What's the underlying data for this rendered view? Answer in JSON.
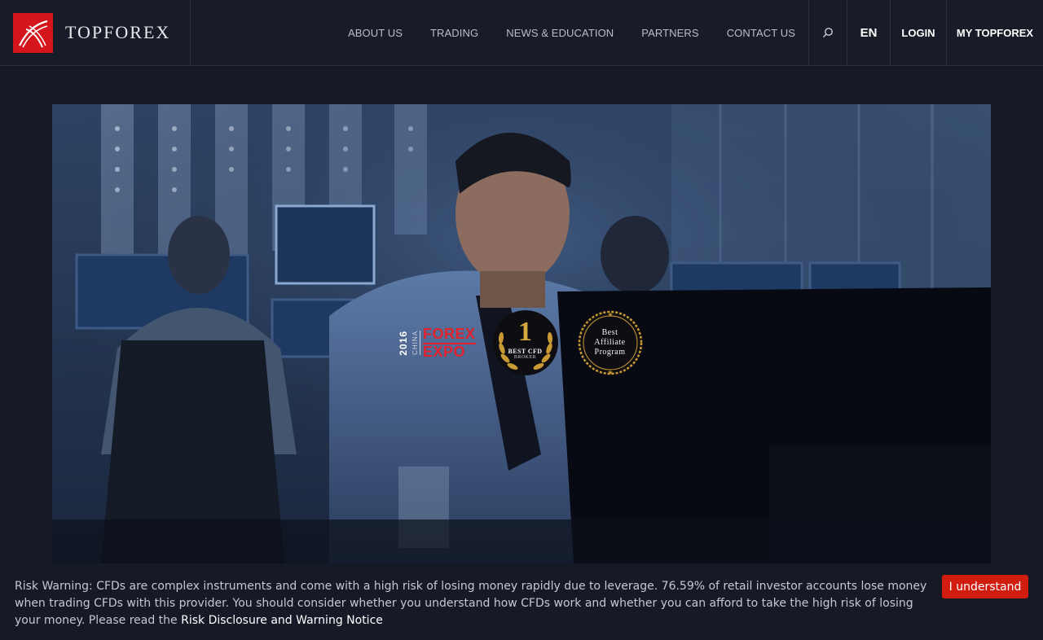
{
  "brand": {
    "name": "TOPFOREX",
    "logo_icon": "topforex-logo-swoosh",
    "logo_color": "#d4161c"
  },
  "nav": {
    "items": [
      {
        "label": "ABOUT US"
      },
      {
        "label": "TRADING"
      },
      {
        "label": "NEWS & EDUCATION"
      },
      {
        "label": "PARTNERS"
      },
      {
        "label": "CONTACT US"
      }
    ],
    "search_icon": "search-icon",
    "language": "EN",
    "login": "LOGIN",
    "my_account": "MY TOPFOREX"
  },
  "hero": {
    "image": "trader-at-monitor-control-room",
    "awards": {
      "expo": {
        "year": "2016",
        "country": "CHINA",
        "line1": "FOREX",
        "line2": "EXPO"
      },
      "badge1": {
        "number": "1",
        "line1": "BEST CFD",
        "line2": "BROKER"
      },
      "badge2": {
        "line1": "Best",
        "line2": "Affiliate",
        "line3": "Program"
      }
    }
  },
  "risk_warning": {
    "text": "Risk Warning: CFDs are complex instruments and come with a high risk of losing money rapidly due to leverage. 76.59% of retail investor accounts lose money when trading CFDs with this provider. You should consider whether you understand how CFDs work and whether you can afford to take the high risk of losing your money. Please read the ",
    "link": "Risk Disclosure and Warning Notice",
    "button": "I understand",
    "button_color": "#d11c10"
  }
}
